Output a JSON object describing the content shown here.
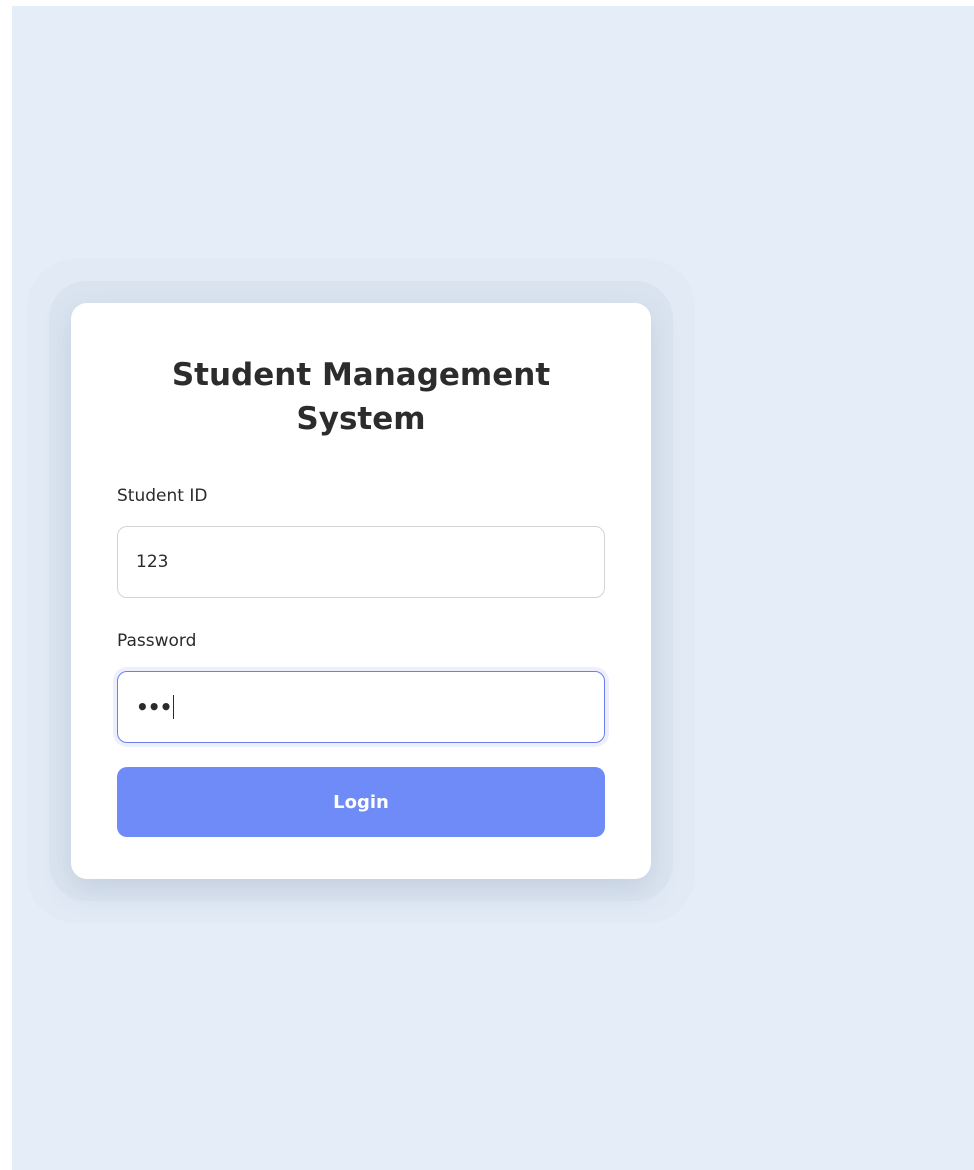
{
  "login": {
    "title": "Student Management System",
    "student_id_label": "Student ID",
    "student_id_value": "123",
    "password_label": "Password",
    "password_masked": "•••",
    "button_label": "Login"
  },
  "colors": {
    "background": "#e5eef8",
    "card": "#ffffff",
    "accent": "#6f8bf7",
    "focus_border": "#6d7ef0",
    "text": "#2b2b2b"
  }
}
